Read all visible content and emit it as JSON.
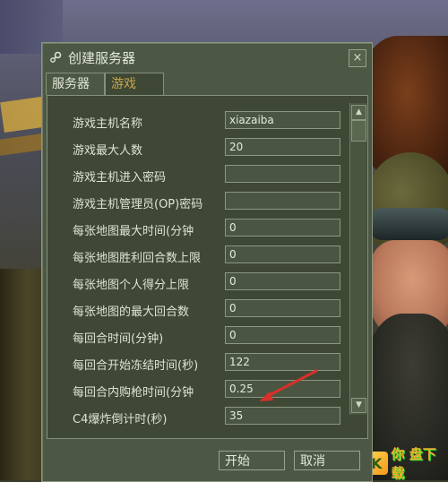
{
  "dialog": {
    "title": "创建服务器",
    "close_label": "×"
  },
  "tabs": [
    {
      "label": "服务器",
      "active": false
    },
    {
      "label": "游戏",
      "active": true
    }
  ],
  "settings": [
    {
      "label": "游戏主机名称",
      "value": "xiazaiba"
    },
    {
      "label": "游戏最大人数",
      "value": "20"
    },
    {
      "label": "游戏主机进入密码",
      "value": ""
    },
    {
      "label": "游戏主机管理员(OP)密码",
      "value": ""
    },
    {
      "label": "每张地图最大时间(分钟",
      "value": "0"
    },
    {
      "label": "每张地图胜利回合数上限",
      "value": "0"
    },
    {
      "label": "每张地图个人得分上限",
      "value": "0"
    },
    {
      "label": "每张地图的最大回合数",
      "value": "0"
    },
    {
      "label": "每回合时间(分钟)",
      "value": "0"
    },
    {
      "label": "每回合开始冻结时间(秒)",
      "value": "122"
    },
    {
      "label": "每回合内购枪时间(分钟",
      "value": "0.25"
    },
    {
      "label": "C4爆炸倒计时(秒)",
      "value": "35"
    }
  ],
  "scrollbar": {
    "up_icon": "▲",
    "down_icon": "▼"
  },
  "buttons": {
    "start_label": "开始",
    "cancel_label": "取消"
  },
  "watermark": {
    "mark": "K",
    "text": "你 盘下载"
  },
  "colors": {
    "dialog_bg": "#4c5844",
    "panel_bg": "#3e4835",
    "active_tab_text": "#c8a64d",
    "annotation_arrow": "#d8302a"
  }
}
